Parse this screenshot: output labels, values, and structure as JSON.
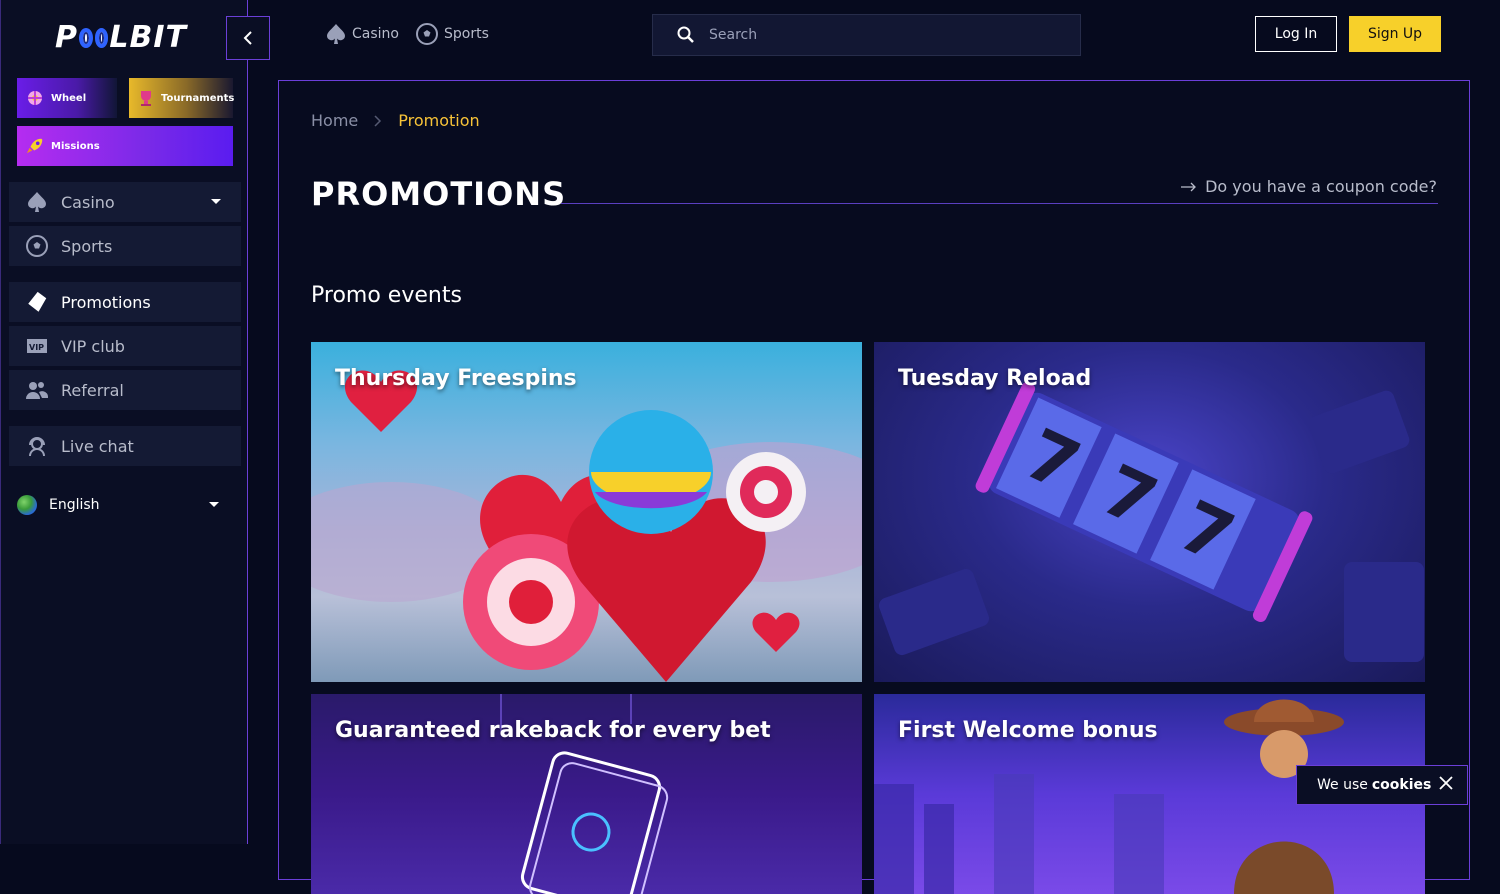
{
  "brand": {
    "logo_text_1": "P",
    "logo_text_2": "LBIT"
  },
  "sidebar": {
    "tiles": [
      {
        "label": "Wheel",
        "icon": "wheel-icon"
      },
      {
        "label": "Tournaments",
        "icon": "trophy-icon"
      },
      {
        "label": "Missions",
        "icon": "rocket-icon"
      }
    ],
    "items": [
      {
        "label": "Casino",
        "icon": "spade-icon"
      },
      {
        "label": "Sports",
        "icon": "soccer-ball-icon"
      },
      {
        "label": "Promotions",
        "icon": "tag-icon"
      },
      {
        "label": "VIP club",
        "icon": "vip-icon"
      },
      {
        "label": "Referral",
        "icon": "users-icon"
      },
      {
        "label": "Live chat",
        "icon": "support-icon"
      }
    ],
    "language": "English"
  },
  "header": {
    "nav": [
      {
        "label": "Casino",
        "icon": "spade-icon"
      },
      {
        "label": "Sports",
        "icon": "soccer-ball-icon"
      }
    ],
    "search_placeholder": "Search",
    "login_label": "Log In",
    "signup_label": "Sign Up"
  },
  "breadcrumb": {
    "home": "Home",
    "current": "Promotion"
  },
  "page": {
    "title": "PROMOTIONS",
    "coupon_link": "Do you have a coupon code?",
    "section_title": "Promo events"
  },
  "cards": [
    {
      "title": "Thursday Freespins"
    },
    {
      "title": "Tuesday Reload"
    },
    {
      "title": "Guaranteed rakeback for every bet"
    },
    {
      "title": "First Welcome bonus"
    }
  ],
  "cookie": {
    "text": "We use",
    "bold": "cookies"
  },
  "colors": {
    "accent": "#6b3fd8",
    "yellow": "#f7d02a",
    "breadcrumb_active": "#f7c338"
  }
}
